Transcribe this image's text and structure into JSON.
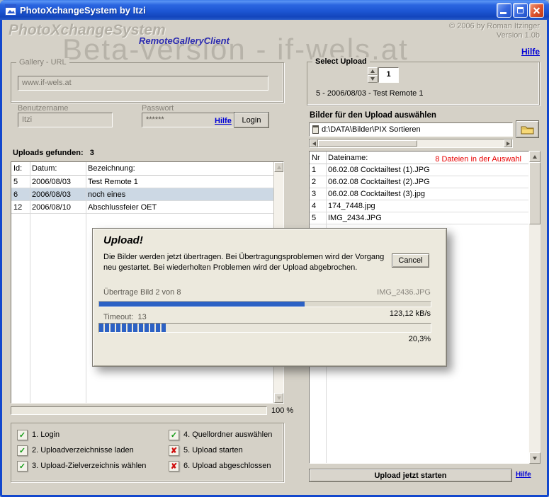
{
  "window": {
    "title": "PhotoXchangeSystem by Itzi"
  },
  "header": {
    "logo": "PhotoXchangeSystem",
    "subtitle": "RemoteGalleryClient",
    "copyright": "© 2006 by Roman Itzinger",
    "version": "Version 1.0b",
    "help_link": "Hilfe",
    "watermark": "Beta-version - if-wels.at"
  },
  "login": {
    "group_label": "Gallery - URL",
    "url_value": "www.if-wels.at",
    "username_label": "Benutzername",
    "username_value": "Itzi",
    "password_label": "Passwort",
    "password_value": "******",
    "help_link": "Hilfe",
    "login_button": "Login"
  },
  "uploads": {
    "found_label": "Uploads gefunden:   3",
    "columns": [
      "Id:",
      "Datum:",
      "Bezeichnung:"
    ],
    "rows": [
      {
        "id": "5",
        "date": "2006/08/03",
        "name": "Test Remote 1",
        "selected": false
      },
      {
        "id": "6",
        "date": "2006/08/03",
        "name": "noch eines",
        "selected": true
      },
      {
        "id": "12",
        "date": "2006/08/10",
        "name": "Abschlussfeier OET",
        "selected": false
      }
    ],
    "progress_label": "100 %"
  },
  "checklist": {
    "items": [
      {
        "label": "1. Login",
        "status": "done"
      },
      {
        "label": "2. Uploadverzeichnisse laden",
        "status": "done"
      },
      {
        "label": "3. Upload-Zielverzeichnis wählen",
        "status": "done"
      },
      {
        "label": "4. Quellordner auswählen",
        "status": "done"
      },
      {
        "label": "5. Upload starten",
        "status": "pending"
      },
      {
        "label": "6. Upload abgeschlossen",
        "status": "pending"
      }
    ]
  },
  "select_upload": {
    "group_label": "Select Upload",
    "spinner_value": "1",
    "selected_text": "5 - 2006/08/03 - Test Remote 1"
  },
  "files": {
    "section_label": "Bilder für den Upload auswählen",
    "path_value": "d:\\DATA\\Bilder\\PIX Sortieren",
    "count_label": "8 Dateien in der Auswahl",
    "columns": [
      "Nr",
      "Dateiname:"
    ],
    "rows": [
      {
        "nr": "1",
        "name": "06.02.08 Cocktailtest (1).JPG"
      },
      {
        "nr": "2",
        "name": "06.02.08 Cocktailtest (2).JPG"
      },
      {
        "nr": "3",
        "name": "06.02.08 Cocktailtest (3).jpg"
      },
      {
        "nr": "4",
        "name": "174_7448.jpg"
      },
      {
        "nr": "5",
        "name": "IMG_2434.JPG"
      }
    ],
    "start_button": "Upload jetzt starten",
    "help_link": "Hilfe"
  },
  "dialog": {
    "title": "Upload!",
    "message": "Die Bilder werden jetzt übertragen. Bei Übertragungsproblemen wird der Vorgang neu gestartet. Bei wiederholten Problemen wird der Upload abgebrochen.",
    "cancel_button": "Cancel",
    "current_file_label": "Übertrage Bild 2 von 8",
    "current_file_name": "IMG_2436.JPG",
    "speed": "123,12 kB/s",
    "timeout_label": "Timeout:  13",
    "percent_label": "20,3%",
    "file_progress_percent": 62,
    "total_progress_percent": 20.3
  },
  "icons": {
    "check": "✓",
    "cross": "✘"
  },
  "colors": {
    "titlebar_blue": "#1d56d4",
    "progress_blue": "#2c61c4",
    "alert_red": "#e80000",
    "link_blue": "#0000d6",
    "check_green": "#0f9a12",
    "cross_red": "#d01010",
    "window_bg": "#d5d1c7",
    "dialog_bg": "#ece9dd"
  }
}
